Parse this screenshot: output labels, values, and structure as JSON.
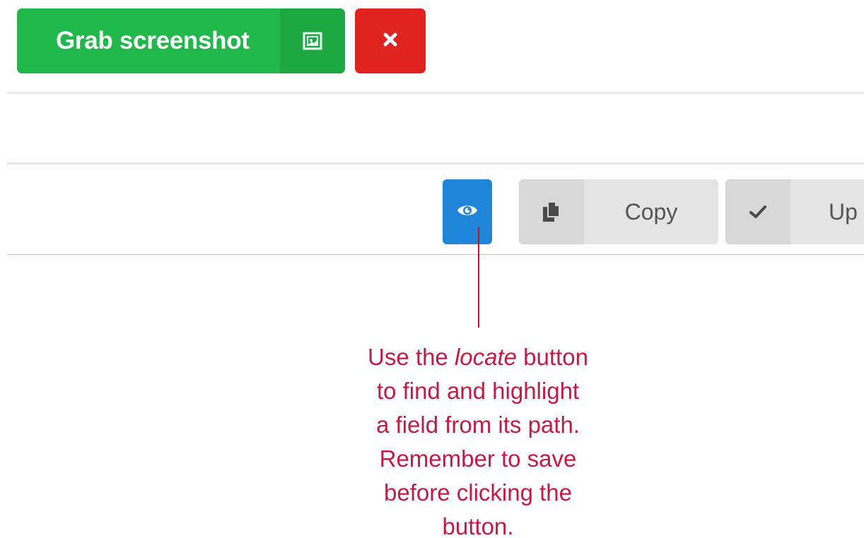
{
  "toolbar": {
    "grab_label": "Grab screenshot",
    "grab_icon": "screenshot-icon",
    "close_icon": "close-icon",
    "grab_color": "#20b84a",
    "close_color": "#e0231e"
  },
  "field_toolbar": {
    "locate_icon": "eye-icon",
    "locate_color": "#1f86d9",
    "copy_icon": "copy-icon",
    "copy_label": "Copy",
    "update_icon": "check-icon",
    "update_label": "Up"
  },
  "annotation": {
    "line1_before": "Use the ",
    "line1_em": "locate",
    "line1_after": " button",
    "line2": "to find and highlight",
    "line3": "a field from its path.",
    "line4": "Remember to save",
    "line5": "before clicking the",
    "line6": "button.",
    "color": "#c21b45"
  }
}
